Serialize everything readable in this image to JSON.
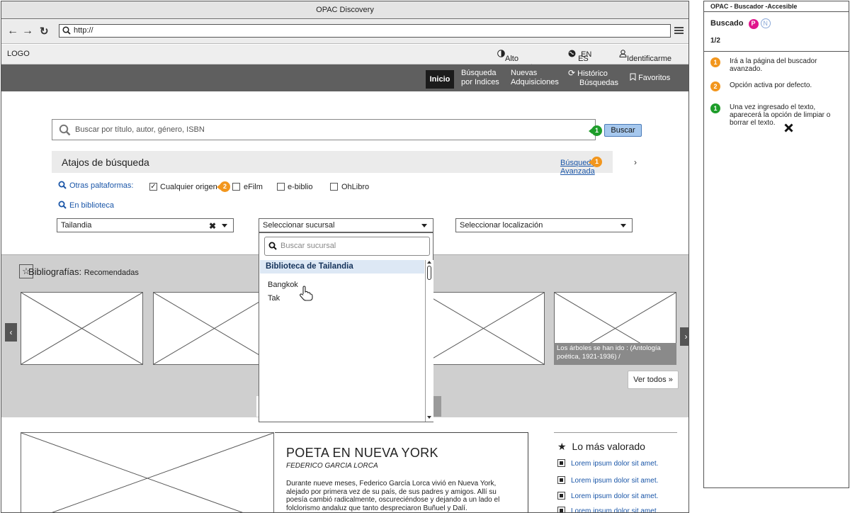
{
  "window": {
    "title": "OPAC Discovery",
    "url": "http://"
  },
  "utilbar": {
    "logo": "LOGO",
    "contrast": "Alto contraste",
    "lang_es": "ES",
    "lang_en": "EN",
    "login": "Identificarme"
  },
  "nav": {
    "inicio": "Inicio",
    "indices_1": "Búsqueda",
    "indices_2": "por Indices",
    "nuevas_1": "Nuevas",
    "nuevas_2": "Adquisiciones",
    "historico_1": "Histórico",
    "historico_2": "Búsquedas",
    "favoritos": "Favoritos"
  },
  "search": {
    "placeholder": "Buscar por título, autor, género, ISBN",
    "button": "Buscar"
  },
  "shortcuts": {
    "title": "Atajos de búsqueda",
    "advanced": "Búsqueda Avanzada",
    "other_platforms": "Otras paltaformas:",
    "options": [
      {
        "label": "Cualquier origen",
        "checked": true
      },
      {
        "label": "eFilm",
        "checked": false
      },
      {
        "label": "e-biblio",
        "checked": false
      },
      {
        "label": "OhLibro",
        "checked": false
      }
    ],
    "in_library": "En biblioteca"
  },
  "filters": {
    "country": "Tailandia",
    "branch": "Seleccionar sucursal",
    "location": "Seleccionar localización"
  },
  "dropdown": {
    "search_placeholder": "Buscar sucursal",
    "group": "Biblioteca de Tailandia",
    "options": [
      "Bangkok",
      "Tak"
    ]
  },
  "bibliographies": {
    "title": "Bibliografías:",
    "subtitle": "Recomendadas",
    "caption": "Los árboles se han ido : (Antología poética, 1921-1936) /",
    "see_all": "Ver todos »"
  },
  "featured": {
    "title": "POETA EN NUEVA YORK",
    "author": "FEDERICO GARCIA LORCA",
    "description": "Durante nueve meses, Federico García Lorca vivió en Nueva York, alejado por primera vez de su país, de sus padres y amigos. Allí su poesía cambió radicalmente, oscureciéndose y dejando a un lado el folclorismo andaluz que tanto despreciaron Buñuel y Dalí."
  },
  "top_rated": {
    "title": "Lo más valorado",
    "items": [
      "Lorem ipsum dolor sit amet.",
      "Lorem ipsum dolor sit amet.",
      "Lorem ipsum dolor sit amet.",
      "Lorem ipsum dolor sit amet."
    ]
  },
  "notes": {
    "header": "OPAC - Buscador -Accesible",
    "section": "Buscado",
    "badge_p": "P",
    "badge_n": "N",
    "page": "1/2",
    "items": [
      {
        "num": "1",
        "color": "#f2961d",
        "text": "Irá a la página del buscador avanzado."
      },
      {
        "num": "2",
        "color": "#f2961d",
        "text": "Opción activa por defecto."
      },
      {
        "num": "1",
        "color": "#1e9d2a",
        "text": "Una vez ingresado el texto, aparecerá la opción de limpiar o borrar el texto."
      }
    ]
  },
  "colors": {
    "nav_bg": "#5f5f5f",
    "accent_blue": "#1a56a8",
    "orange": "#f2961d",
    "green": "#1e9d2a",
    "pink": "#e0158c"
  }
}
